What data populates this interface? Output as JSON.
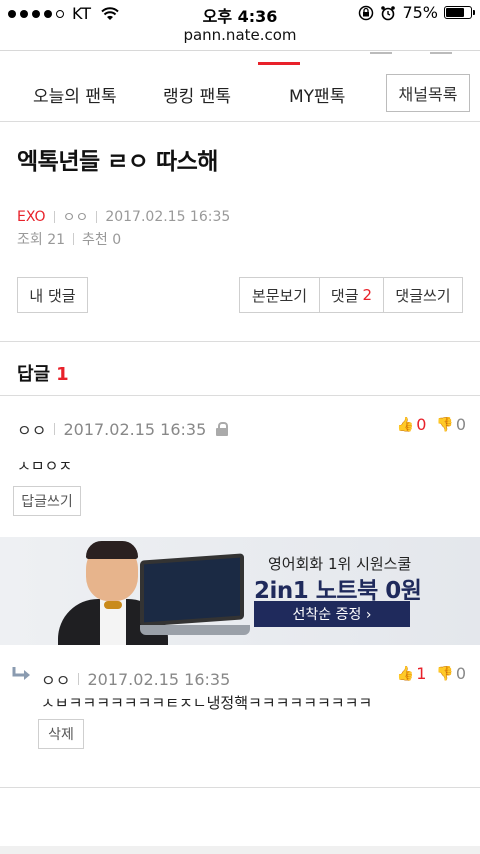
{
  "status_bar": {
    "carrier": "KT",
    "time": "오후 4:36",
    "battery": "75%",
    "battery_level": 0.75
  },
  "browser": {
    "url": "pann.nate.com"
  },
  "nav": {
    "tabs": [
      "오늘의 팬톡",
      "랭킹 팬톡",
      "MY팬톡"
    ],
    "channel_list": "채널목록"
  },
  "post": {
    "title": "엑톡년들 ㄹㅇ 따스해",
    "channel": "EXO",
    "author": "ㅇㅇ",
    "date": "2017.02.15 16:35",
    "views": "조회 21",
    "recommend": "추천 0"
  },
  "actions": {
    "my_comments": "내 댓글",
    "view_body": "본문보기",
    "comments_label": "댓글",
    "comments_count": "2",
    "write_comment": "댓글쓰기"
  },
  "replies": {
    "label": "답글",
    "count": "1"
  },
  "comments": [
    {
      "author": "ㅇㅇ",
      "date": "2017.02.15 16:35",
      "up": "0",
      "down": "0",
      "text": "ㅅㅁㅇㅈ",
      "button": "답글쓰기"
    },
    {
      "author": "ㅇㅇ",
      "date": "2017.02.15 16:35",
      "up": "1",
      "down": "0",
      "text": "ㅅㅂㅋㅋㅋㅋㅋㅋㅋㅌㅈㄴ냉정핵ㅋㅋㅋㅋㅋㅋㅋㅋㅋ",
      "button": "삭제"
    }
  ],
  "ad": {
    "line1": "영어회화 1위 시원스쿨",
    "line2": "2in1 노트북 0원",
    "line3": "선착순 증정 ›"
  },
  "colors": {
    "accent": "#e8212a",
    "ad_navy": "#1f2a5c"
  }
}
